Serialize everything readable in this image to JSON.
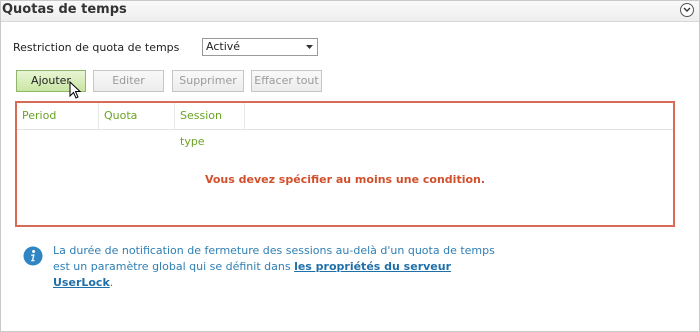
{
  "header": {
    "title": "Quotas de temps",
    "collapse_icon": "chevron-down-icon"
  },
  "restriction": {
    "label": "Restriction de quota de temps",
    "selected": "Activé"
  },
  "toolbar": {
    "add_label": "Ajouter",
    "edit_label": "Editer",
    "delete_label": "Supprimer",
    "clear_label": "Effacer tout"
  },
  "table": {
    "columns": [
      "Period",
      "Quota",
      "Session type"
    ],
    "rows": [],
    "empty_message": "Vous devez spécifier au moins une condition."
  },
  "info": {
    "text_before": "La durée de notification de fermeture des sessions au-delà d'un quota de temps est un paramètre global qui se définit dans ",
    "link_text": "les propriétés du serveur UserLock",
    "text_after": "."
  },
  "colors": {
    "accent_green": "#6aa324",
    "error_red": "#d24f2b",
    "info_blue": "#2f7fb3"
  }
}
